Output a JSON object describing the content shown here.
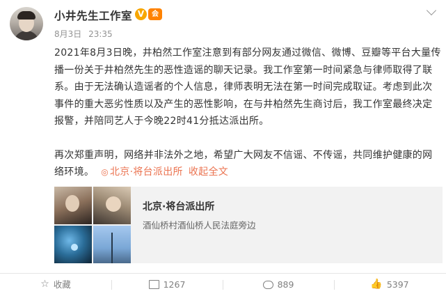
{
  "post": {
    "author": "小井先生工作室",
    "verified_badge": "V",
    "member_badge": "会",
    "date": "8月3日",
    "time": "23:35",
    "content": {
      "paragraph1": "2021年8月3日晚，井柏然工作室注意到有部分网友通过微信、微博、豆瓣等平台大量传播一份关于井柏然先生的恶性造谣的聊天记录。我工作室第一时间紧急与律师取得了联系。由于无法确认造谣者的个人信息，律师表明无法在第一时间完成取证。考虑到此次事件的重大恶劣性质以及产生的恶性影响，在与井柏然先生商讨后，我工作室最终决定报警，并陪同艺人于今晚22时41分抵达派出所。",
      "paragraph2": "再次郑重声明，网络并非法外之地，希望广大网友不信谣、不传谣，共同维护健康的网络环境。",
      "location_link": "北京·将台派出所",
      "fold_link": "收起全文"
    },
    "location_card": {
      "name": "北京·将台派出所",
      "address": "酒仙桥村酒仙桥人民法庭旁边"
    },
    "actions": {
      "favorite_label": "收藏",
      "repost_count": "1267",
      "comment_count": "889",
      "like_count": "5397"
    }
  },
  "colors": {
    "link": "#eb7350",
    "muted": "#939393",
    "verified": "#f7a600"
  }
}
